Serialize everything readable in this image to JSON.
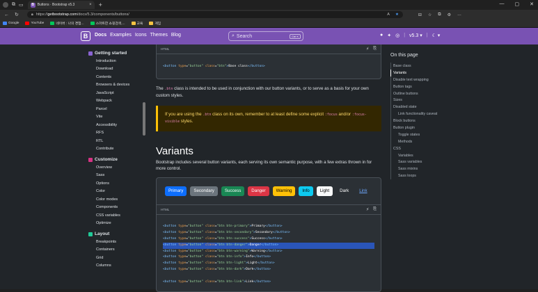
{
  "browser": {
    "tab_title": "Buttons · Bootstrap v5.3",
    "tab_fav": "B",
    "url_prefix": "https://",
    "url_host": "getbootstrap.com",
    "url_path": "/docs/5.3/components/buttons/",
    "bookmarks": [
      {
        "label": "Google",
        "color": "#4285f4"
      },
      {
        "label": "YouTube",
        "color": "#ff0000"
      },
      {
        "label": "네이버 : 나의 경험...",
        "color": "#03c75a"
      },
      {
        "label": "스마트한 쇼핑검색,...",
        "color": "#03c75a"
      },
      {
        "label": "교육",
        "color": "#f6c343"
      },
      {
        "label": "게임",
        "color": "#f6c343"
      }
    ]
  },
  "navbar": {
    "brand": "B",
    "links": [
      "Docs",
      "Examples",
      "Icons",
      "Themes",
      "Blog"
    ],
    "search_placeholder": "Search",
    "search_kbd": "Ctrl K",
    "version": "v5.3",
    "accent": "#7952b3"
  },
  "sidebar": {
    "sections": [
      {
        "title": "Getting started",
        "color": "#8a63d2",
        "items": [
          "Introduction",
          "Download",
          "Contents",
          "Browsers & devices",
          "JavaScript",
          "Webpack",
          "Parcel",
          "Vite",
          "Accessibility",
          "RFS",
          "RTL",
          "Contribute"
        ]
      },
      {
        "title": "Customize",
        "color": "#d63384",
        "items": [
          "Overview",
          "Sass",
          "Options",
          "Color",
          "Color modes",
          "Components",
          "CSS variables",
          "Optimize"
        ]
      },
      {
        "title": "Layout",
        "color": "#20c997",
        "items": [
          "Breakpoints",
          "Containers",
          "Grid",
          "Columns"
        ]
      }
    ]
  },
  "content": {
    "code1_label": "HTML",
    "code1_line": {
      "tag": "button",
      "type": "button",
      "cls": "btn",
      "text": "Base class"
    },
    "para1": [
      "The ",
      ".btn",
      " class is intended to be used in conjunction with our button variants, or to serve as a basis for your own custom styles."
    ],
    "alert": [
      "If you are using the ",
      ".btn",
      " class on its own, remember to at least define some explicit ",
      ":focus",
      " and/or ",
      ":focus-visible",
      " styles."
    ],
    "heading": "Variants",
    "para2": "Bootstrap includes several button variants, each serving its own semantic purpose, with a few extras thrown in for more control.",
    "buttons": [
      {
        "label": "Primary",
        "bg": "#0d6efd",
        "fg": "#ffffff"
      },
      {
        "label": "Secondary",
        "bg": "#6c757d",
        "fg": "#ffffff"
      },
      {
        "label": "Success",
        "bg": "#198754",
        "fg": "#ffffff"
      },
      {
        "label": "Danger",
        "bg": "#dc3545",
        "fg": "#ffffff"
      },
      {
        "label": "Warning",
        "bg": "#ffc107",
        "fg": "#000000"
      },
      {
        "label": "Info",
        "bg": "#0dcaf0",
        "fg": "#000000"
      },
      {
        "label": "Light",
        "bg": "#f8f9fa",
        "fg": "#000000"
      },
      {
        "label": "Dark",
        "bg": "transparent",
        "fg": "#ffffff"
      },
      {
        "label": "Link",
        "bg": "transparent",
        "fg": "#6ea8fe"
      }
    ],
    "code2_label": "HTML",
    "code2_lines": [
      {
        "cls": "btn btn-primary",
        "text": "Primary",
        "hl": false
      },
      {
        "cls": "btn btn-secondary",
        "text": "Secondary",
        "hl": false
      },
      {
        "cls": "btn btn-success",
        "text": "Success",
        "hl": false
      },
      {
        "cls": "btn btn-danger",
        "text": "Danger",
        "hl": true
      },
      {
        "cls": "btn btn-warning",
        "text": "Warning",
        "hl": false
      },
      {
        "cls": "btn btn-info",
        "text": "Info",
        "hl": false
      },
      {
        "cls": "btn btn-light",
        "text": "Light",
        "hl": false
      },
      {
        "cls": "btn btn-dark",
        "text": "Dark",
        "hl": false
      },
      {
        "cls": "",
        "text": "",
        "hl": false
      },
      {
        "cls": "btn btn-link",
        "text": "Link",
        "hl": false
      }
    ]
  },
  "toc": {
    "title": "On this page",
    "items": [
      {
        "label": "Base class",
        "level": 1,
        "active": false
      },
      {
        "label": "Variants",
        "level": 1,
        "active": true
      },
      {
        "label": "Disable text wrapping",
        "level": 1,
        "active": false
      },
      {
        "label": "Button tags",
        "level": 1,
        "active": false
      },
      {
        "label": "Outline buttons",
        "level": 1,
        "active": false
      },
      {
        "label": "Sizes",
        "level": 1,
        "active": false
      },
      {
        "label": "Disabled state",
        "level": 1,
        "active": false
      },
      {
        "label": "Link functionality caveat",
        "level": 2,
        "active": false
      },
      {
        "label": "Block buttons",
        "level": 1,
        "active": false
      },
      {
        "label": "Button plugin",
        "level": 1,
        "active": false
      },
      {
        "label": "Toggle states",
        "level": 2,
        "active": false
      },
      {
        "label": "Methods",
        "level": 2,
        "active": false
      },
      {
        "label": "CSS",
        "level": 1,
        "active": false
      },
      {
        "label": "Variables",
        "level": 2,
        "active": false
      },
      {
        "label": "Sass variables",
        "level": 2,
        "active": false
      },
      {
        "label": "Sass mixins",
        "level": 2,
        "active": false
      },
      {
        "label": "Sass loops",
        "level": 2,
        "active": false
      }
    ]
  }
}
